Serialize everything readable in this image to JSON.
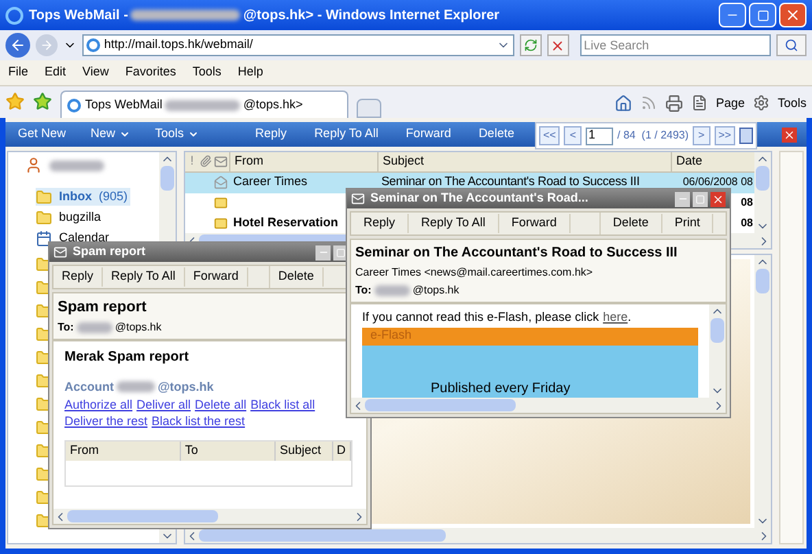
{
  "window": {
    "title_prefix": "Tops WebMail -",
    "title_suffix": "@tops.hk> - Windows Internet Explorer"
  },
  "address_bar": {
    "url": "http://mail.tops.hk/webmail/"
  },
  "search": {
    "placeholder": "Live Search"
  },
  "menu": [
    "File",
    "Edit",
    "View",
    "Favorites",
    "Tools",
    "Help"
  ],
  "browser_tab": {
    "title_prefix": "Tops WebMail",
    "title_suffix": "@tops.hk>"
  },
  "command_bar": [
    "Page",
    "Tools"
  ],
  "toolbar": {
    "left": [
      {
        "label": "Get New",
        "dropdown": false
      },
      {
        "label": "New",
        "dropdown": true
      },
      {
        "label": "Tools",
        "dropdown": true
      }
    ],
    "right": [
      "Reply",
      "Reply To All",
      "Forward",
      "Delete"
    ]
  },
  "pager": {
    "first": "<<",
    "prev": "<",
    "page": "1",
    "total": "/ 84  (1 / 2493)",
    "next": ">",
    "last": ">>"
  },
  "folders": [
    {
      "label": "Inbox",
      "count": "(905)",
      "selected": true
    },
    {
      "label": "bugzilla",
      "selected": false
    },
    {
      "label": "Calendar",
      "selected": false
    }
  ],
  "message_list": {
    "flag_header": "!",
    "columns": [
      "From",
      "Subject",
      "Date"
    ],
    "rows": [
      {
        "from": "Career Times",
        "subject": "Seminar on The Accountant's Road to Success III",
        "date": "06/06/2008 08",
        "selected": true,
        "unread": false
      },
      {
        "date": "08",
        "selected": false,
        "unread": true
      },
      {
        "from": "Hotel Reservation",
        "date": "08",
        "selected": false,
        "unread": true
      }
    ]
  },
  "spam_window": {
    "title": "Spam report",
    "actions": [
      "Reply",
      "Reply To All",
      "Forward",
      "Delete"
    ],
    "heading": "Spam report",
    "to_label": "To:",
    "to_domain": "@tops.hk",
    "body_title": "Merak Spam report",
    "account_label": "Account",
    "account_domain": "@tops.hk",
    "links": [
      "Authorize all",
      "Deliver all",
      "Delete all",
      "Black list all",
      "Deliver the rest",
      "Black list the rest"
    ],
    "columns": [
      "From",
      "To",
      "Subject",
      "D"
    ]
  },
  "message_window": {
    "title": "Seminar on The Accountant's Road...",
    "actions": [
      "Reply",
      "Reply To All",
      "Forward",
      "Delete",
      "Print"
    ],
    "subject": "Seminar on The Accountant's Road to Success III",
    "from": "Career Times <news@mail.careertimes.com.hk>",
    "to_label": "To:",
    "to_domain": "@tops.hk",
    "notice": "If you cannot read this e-Flash, please click",
    "notice_link": "here",
    "notice_end": ".",
    "banner": "e-Flash",
    "tagline": "Published every Friday"
  }
}
